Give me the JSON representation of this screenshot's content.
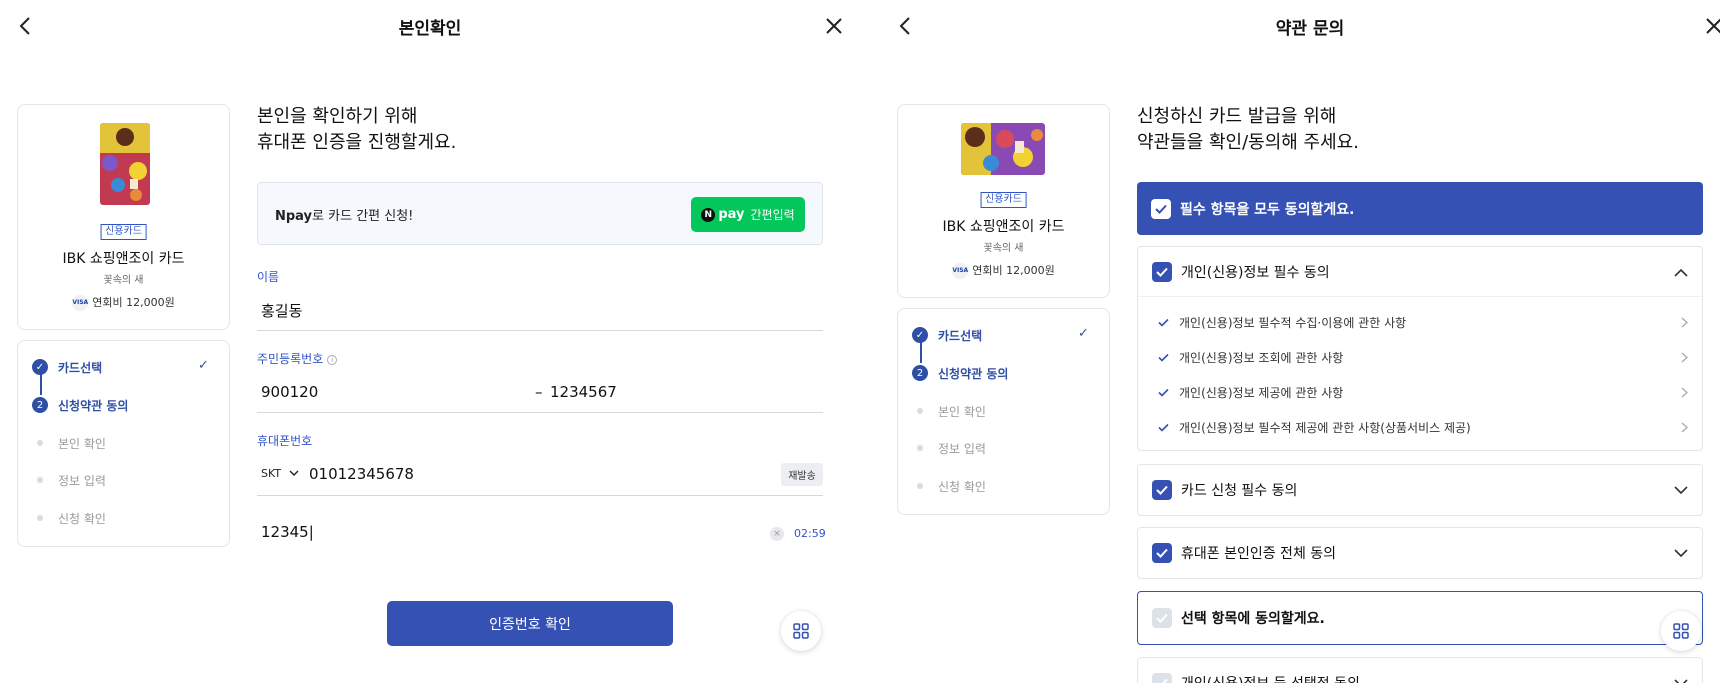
{
  "left": {
    "title": "본인확인",
    "card": {
      "tag": "신용카드",
      "name": "IBK 쇼핑앤조이 카드",
      "sub": "꽃속의 새",
      "visa": "VISA",
      "fee": "연회비 12,000원"
    },
    "steps": [
      {
        "num": "1",
        "label": "카드선택",
        "state": "done"
      },
      {
        "num": "2",
        "label": "신청약관 동의",
        "state": "current"
      },
      {
        "num": "",
        "label": "본인 확인",
        "state": "todo"
      },
      {
        "num": "",
        "label": "정보 입력",
        "state": "todo"
      },
      {
        "num": "",
        "label": "신청 확인",
        "state": "todo"
      }
    ],
    "heading_line1": "본인을 확인하기 위해",
    "heading_line2": "휴대폰 인증을 진행할게요.",
    "npay": {
      "text_bold": "Npay",
      "text_rest": "로 카드 간편 신청!",
      "btn_n": "N",
      "btn_pay": "pay",
      "btn_label": "간편입력"
    },
    "name_field": {
      "label": "이름",
      "value": "홍길동"
    },
    "rrn_field": {
      "label": "주민등록번호",
      "front": "900120",
      "dash": "–",
      "back": "1234567"
    },
    "phone_field": {
      "label": "휴대폰번호",
      "carrier": "SKT",
      "number": "01012345678",
      "resend": "재발송"
    },
    "code_field": {
      "value": "12345|",
      "clear": "×",
      "timer": "02:59"
    },
    "confirm_button": "인증번호 확인"
  },
  "right": {
    "title": "약관 문의",
    "card": {
      "tag": "신용카드",
      "name": "IBK 쇼핑앤조이 카드",
      "sub": "꽃속의 새",
      "visa": "VISA",
      "fee": "연회비 12,000원"
    },
    "steps": [
      {
        "num": "1",
        "label": "카드선택",
        "state": "done"
      },
      {
        "num": "2",
        "label": "신청약관 동의",
        "state": "current"
      },
      {
        "num": "",
        "label": "본인 확인",
        "state": "todo"
      },
      {
        "num": "",
        "label": "정보 입력",
        "state": "todo"
      },
      {
        "num": "",
        "label": "신청 확인",
        "state": "todo"
      }
    ],
    "heading_line1": "신청하신 카드 발급을 위해",
    "heading_line2": "약관들을 확인/동의해 주세요.",
    "agree_all": "필수 항목을 모두 동의할게요.",
    "groups": {
      "personal": {
        "label": "개인(신용)정보 필수 동의",
        "items": [
          "개인(신용)정보 필수적 수집·이용에 관한 사항",
          "개인(신용)정보 조회에 관한 사항",
          "개인(신용)정보 제공에 관한 사항",
          "개인(신용)정보 필수적 제공에 관한 사항(상품서비스 제공)"
        ]
      },
      "card_apply": {
        "label": "카드 신청 필수 동의"
      },
      "phone_auth": {
        "label": "휴대폰 본인인증 전체 동의"
      },
      "optional": {
        "label": "선택 항목에 동의할게요."
      },
      "optional_next": {
        "label": "개인(신용)정보 등 선택적 동의"
      }
    }
  },
  "colors": {
    "primary": "#3551b4",
    "npay_green": "#03c75a",
    "accent_text": "#2f54c9"
  }
}
